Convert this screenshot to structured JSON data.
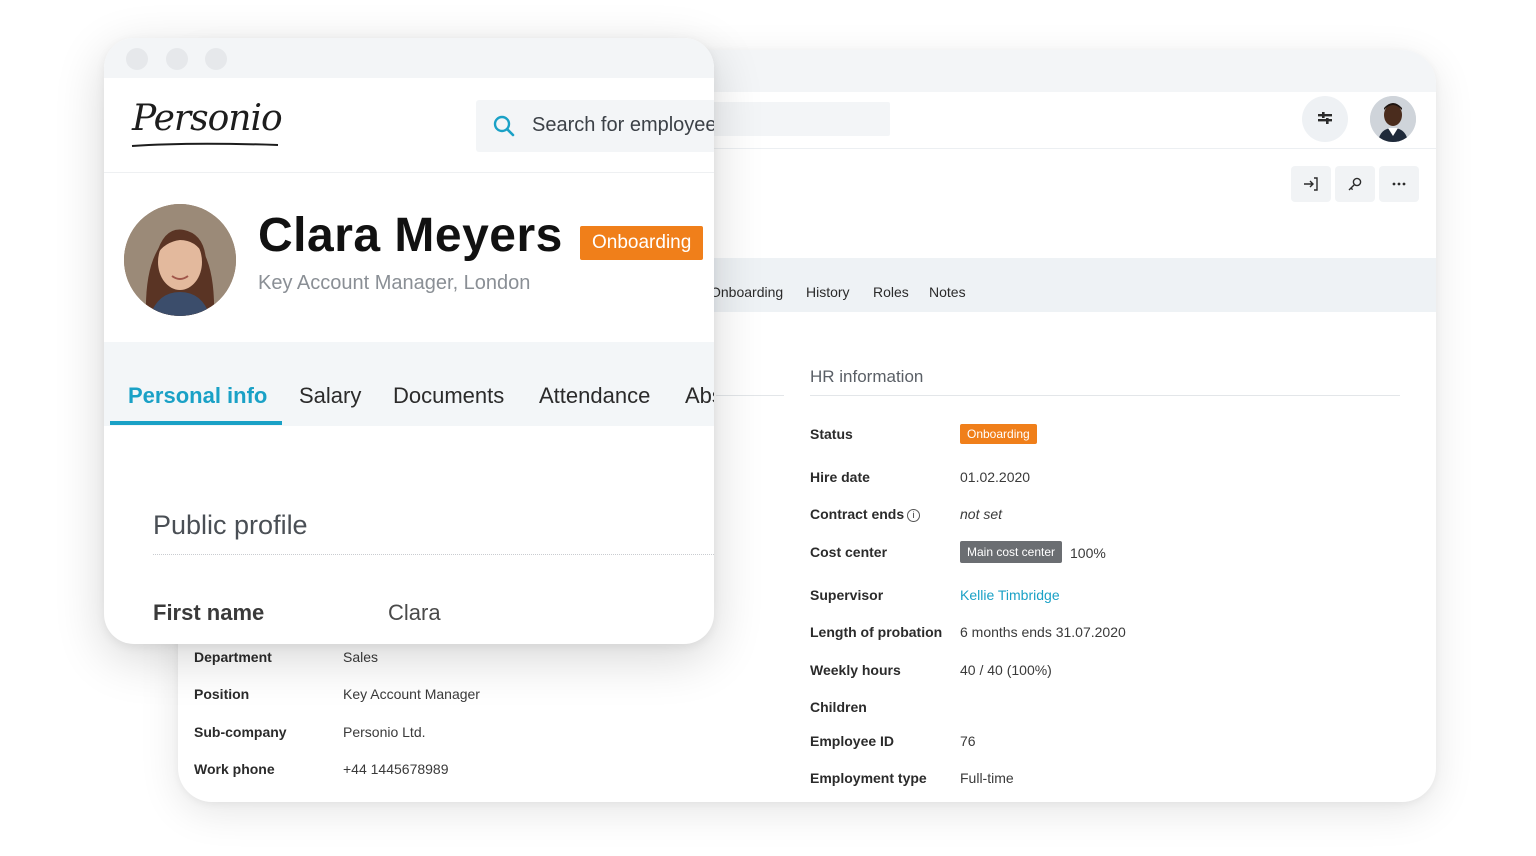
{
  "back": {
    "tabs": [
      "Onboarding",
      "History",
      "Roles",
      "Notes"
    ],
    "hr": {
      "title": "HR information",
      "fields": [
        {
          "label": "Status",
          "value": "Onboarding"
        },
        {
          "label": "Hire date",
          "value": "01.02.2020"
        },
        {
          "label": "Contract ends",
          "value": "not set"
        },
        {
          "label": "Cost center",
          "value": "Main cost center",
          "extra": "100%"
        },
        {
          "label": "Supervisor",
          "value": "Kellie Timbridge"
        },
        {
          "label": "Length of probation",
          "value": "6 months ends 31.07.2020"
        },
        {
          "label": "Weekly hours",
          "value": "40 / 40 (100%)"
        },
        {
          "label": "Children",
          "value": ""
        },
        {
          "label": "Employee ID",
          "value": "76"
        },
        {
          "label": "Employment type",
          "value": "Full-time"
        }
      ]
    },
    "left_fields": [
      {
        "label": "Department",
        "value": "Sales"
      },
      {
        "label": "Position",
        "value": "Key Account Manager"
      },
      {
        "label": "Sub-company",
        "value": "Personio Ltd."
      },
      {
        "label": "Work phone",
        "value": "+44 1445678989"
      }
    ],
    "icons": [
      "filter-icon",
      "sign-in-icon",
      "key-icon",
      "more-icon"
    ]
  },
  "front": {
    "logo": "Personio",
    "search_placeholder": "Search for employee",
    "employee": {
      "name": "Clara Meyers",
      "status": "Onboarding",
      "subtitle": "Key Account Manager, London"
    },
    "tabs": [
      "Personal info",
      "Salary",
      "Documents",
      "Attendance",
      "Abs"
    ],
    "active_tab": "Personal info",
    "section_title": "Public profile",
    "first_name_label": "First name",
    "first_name_value": "Clara"
  },
  "colors": {
    "accent": "#1aa1c6",
    "badge": "#f07f1a",
    "cost_badge": "#6b6e72"
  }
}
